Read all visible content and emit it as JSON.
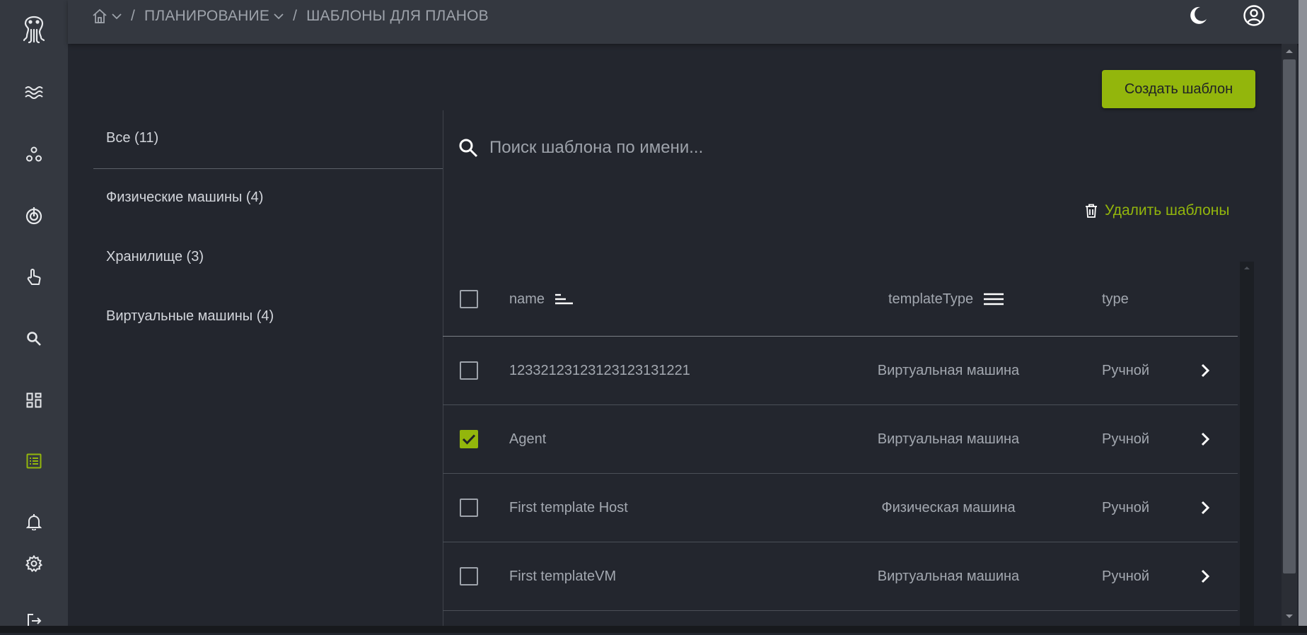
{
  "colors": {
    "accent": "#93b60c",
    "sidebar_bg": "#343840",
    "main_bg": "#23262e",
    "muted_text": "#a3a8b0"
  },
  "sidebar": {
    "items": [
      {
        "icon": "octopus-logo-icon"
      },
      {
        "icon": "waves-icon"
      },
      {
        "icon": "nodes-icon"
      },
      {
        "icon": "target-icon"
      },
      {
        "icon": "touch-hand-icon"
      },
      {
        "icon": "search-icon"
      },
      {
        "icon": "dashboard-icon"
      },
      {
        "icon": "list-icon",
        "active": true
      },
      {
        "icon": "bell-icon"
      },
      {
        "icon": "gear-icon"
      },
      {
        "icon": "logout-icon"
      }
    ]
  },
  "breadcrumb": {
    "home_icon": "home-icon",
    "separator": "/",
    "items": [
      "ПЛАНИРОВАНИЕ",
      "ШАБЛОНЫ ДЛЯ ПЛАНОВ"
    ]
  },
  "header": {
    "theme_icon": "moon-icon",
    "account_icon": "account-circle-icon"
  },
  "create_button": {
    "label": "Создать шаблон"
  },
  "categories": [
    {
      "label": "Все (11)"
    },
    {
      "label": "Физические машины (4)"
    },
    {
      "label": "Хранилище (3)"
    },
    {
      "label": "Виртуальные машины (4)"
    }
  ],
  "search": {
    "placeholder": "Поиск шаблона по имени...",
    "value": ""
  },
  "delete_button": {
    "label": "Удалить шаблоны"
  },
  "table": {
    "columns": [
      "name",
      "templateType",
      "type"
    ],
    "rows": [
      {
        "name": "12332123123123123131221",
        "templateType": "Виртуальная машина",
        "type": "Ручной",
        "checked": false
      },
      {
        "name": "Agent",
        "templateType": "Виртуальная машина",
        "type": "Ручной",
        "checked": true
      },
      {
        "name": "First template Host",
        "templateType": "Физическая машина",
        "type": "Ручной",
        "checked": false
      },
      {
        "name": "First templateVM",
        "templateType": "Виртуальная машина",
        "type": "Ручной",
        "checked": false
      }
    ]
  }
}
